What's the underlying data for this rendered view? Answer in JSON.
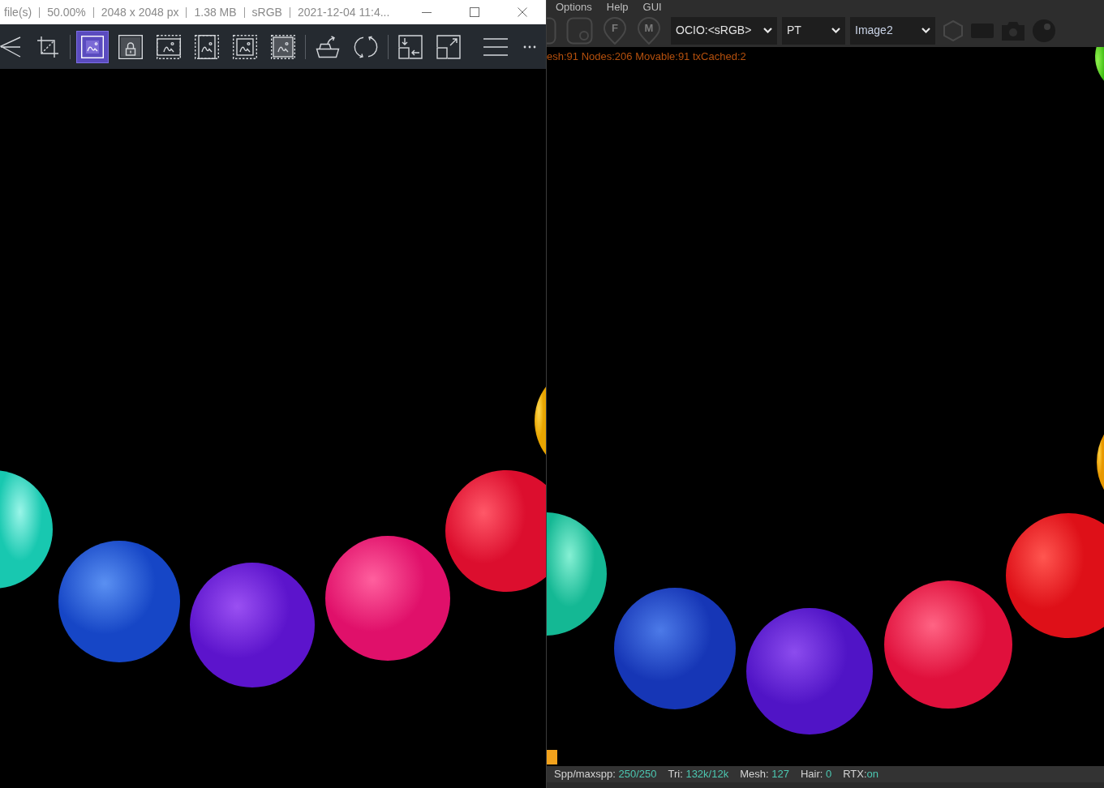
{
  "left_window": {
    "title_bar": {
      "segments": [
        "file(s)",
        "50.00%",
        "2048 x 2048 px",
        "1.38 MB",
        "sRGB",
        "2021-12-04 11:4..."
      ]
    },
    "toolbar": {
      "groups": [
        [
          {
            "kind": "back",
            "selected": false
          },
          {
            "kind": "crop",
            "selected": false
          }
        ],
        [
          {
            "kind": "fit",
            "selected": true
          },
          {
            "kind": "lock",
            "selected": false
          },
          {
            "kind": "frame-wide",
            "selected": false
          },
          {
            "kind": "frame-tall",
            "selected": false
          },
          {
            "kind": "frame-small",
            "selected": false
          },
          {
            "kind": "frame-fill",
            "selected": false
          }
        ],
        [
          {
            "kind": "export",
            "selected": false
          },
          {
            "kind": "rotate",
            "selected": false
          }
        ],
        [
          {
            "kind": "import",
            "selected": false
          },
          {
            "kind": "expand",
            "selected": false
          },
          {
            "kind": "menu",
            "selected": false
          },
          {
            "kind": "more",
            "selected": false
          }
        ]
      ]
    }
  },
  "right_window": {
    "menu": [
      "Options",
      "Help",
      "GUI"
    ],
    "toolbar": {
      "tools_left": [
        {
          "kind": "tile",
          "disabled": true
        },
        {
          "kind": "record",
          "disabled": true
        },
        {
          "kind": "pin",
          "label": "F",
          "disabled": true
        },
        {
          "kind": "pin",
          "label": "M",
          "disabled": true
        }
      ],
      "dropdowns": [
        {
          "value": "OCIO:<sRGB>"
        },
        {
          "value": "PT"
        },
        {
          "value": "Image2"
        }
      ],
      "tools_right": [
        {
          "kind": "hexagon",
          "disabled": true
        },
        {
          "kind": "film",
          "disabled": true
        },
        {
          "kind": "camera",
          "disabled": true
        },
        {
          "kind": "sphere",
          "disabled": true
        }
      ]
    },
    "viewport": {
      "info": "esh:91 Nodes:206 Movable:91 txCached:2"
    },
    "status_bar": [
      {
        "label": "Spp/maxspp: ",
        "value": "250/250"
      },
      {
        "label": "Tri: ",
        "value": "132k/12k"
      },
      {
        "label": "Mesh: ",
        "value": "127"
      },
      {
        "label": "Hair: ",
        "value": "0"
      },
      {
        "label": "RTX:",
        "value": "on"
      }
    ]
  }
}
